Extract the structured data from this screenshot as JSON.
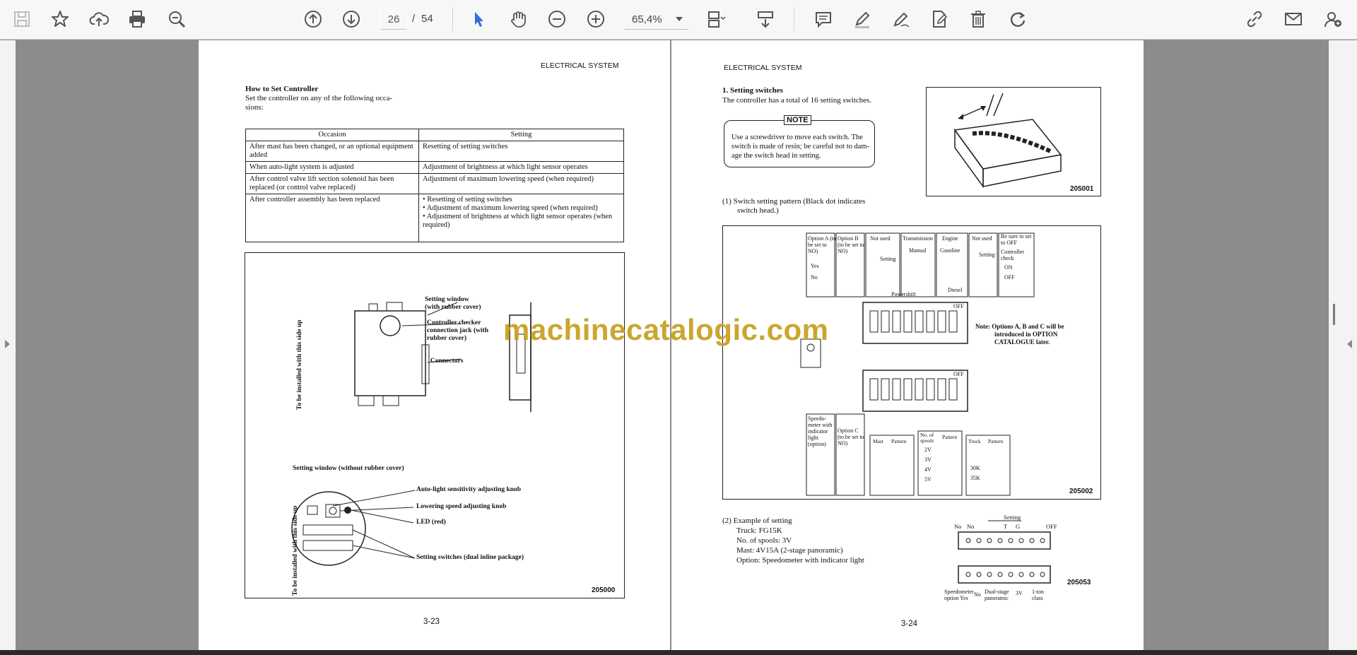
{
  "toolbar": {
    "current_page": "26",
    "page_separator": "/",
    "total_pages": "54",
    "zoom": "65,4%"
  },
  "left_page": {
    "header": "ELECTRICAL SYSTEM",
    "title": "How to Set Controller",
    "intro_line1": "Set the controller on any of the following occa-",
    "intro_line2": "sions:",
    "table": {
      "headers": [
        "Occasion",
        "Setting"
      ],
      "rows": [
        {
          "occasion": "After mast has been changed, or an optional equipment added",
          "setting": [
            "Resetting of setting switches"
          ]
        },
        {
          "occasion": "When auto-light system is adjusted",
          "setting": [
            "Adjustment of brightness at which light sensor operates"
          ]
        },
        {
          "occasion": "After control valve lift section solenoid has been replaced (or control valve replaced)",
          "setting": [
            "Adjustment of maximum lowering speed (when required)"
          ]
        },
        {
          "occasion": "After controller assembly has been replaced",
          "setting": [
            "Resetting of setting switches",
            "Adjustment of maximum lowering speed (when required)",
            "Adjustment of brightness at which light sensor operates (when required)"
          ]
        }
      ]
    },
    "figure": {
      "side_label": "To be installed with this side up",
      "setting_window_label_1": "Setting window",
      "setting_window_label_2": "(with rubber cover)",
      "checker_label_1": "Controller checker",
      "checker_label_2": "connection jack (with",
      "checker_label_3": "rubber cover)",
      "connectors_label": "Connectors",
      "window_title": "Setting window (without rubber cover)",
      "knob1": "Auto-light sensitivity adjusting knob",
      "knob2": "Lowering speed adjusting knob",
      "led": "LED (red)",
      "switches": "Setting switches (dual inline package)",
      "side_label_2": "To be installed with this side up",
      "fig_no": "205000"
    },
    "page_number": "3-23"
  },
  "right_page": {
    "header": "ELECTRICAL SYSTEM",
    "section_title": "1.  Setting switches",
    "section_text": "The controller has a total of 16 setting switches.",
    "note_label": "NOTE",
    "note_line1": "Use a screwdriver to move each switch. The",
    "note_line2": "switch is made of resin; be careful not to dam-",
    "note_line3": "age the switch head in setting.",
    "fig1_no": "205001",
    "pattern_line1": "(1)  Switch setting pattern (Black dot indicates",
    "pattern_line2": "switch head.)",
    "fig2": {
      "optA": "Option A (to be set to NO)",
      "optB": "Option B (to be set to NO)",
      "not_used": "Not used",
      "setting": "Setting",
      "transmission": "Transmission",
      "manual": "Manual",
      "powershift": "Powershift",
      "engine": "Engine",
      "gasoline": "Gasoline",
      "diesel": "Diesel",
      "not_used_2": "Not used",
      "setting_2": "Setting",
      "be_sure": "Be sure to set to OFF",
      "controller_check": "Controller check",
      "on": "ON",
      "off": "OFF",
      "yes": "Yes",
      "no": "No",
      "off_label": "OFF",
      "note_1": "Note: Options A, B and C will be",
      "note_2": "introduced in OPTION",
      "note_3": "CATALOGUE later.",
      "speedo": "Speedo-meter with indicator light (option)",
      "optC": "Option C (to be set to NO)",
      "mast": "Mast",
      "pattern": "Pattern",
      "spools": "No. of spools",
      "truck": "Truck",
      "spool_vals": [
        "2V",
        "3V",
        "4V",
        "5V"
      ],
      "truck_vals": [
        "30K",
        "35K"
      ],
      "fig_no": "205002"
    },
    "example": {
      "line1": "(2)  Example of setting",
      "line2": "Truck: FG15K",
      "line3": "No. of spools: 3V",
      "line4": "Mast: 4V15A (2-stage panoramic)",
      "line5": "Option: Speedometer with indicator light",
      "setting_lbl": "Setting",
      "no1": "No",
      "no2": "No",
      "t": "T",
      "g": "G",
      "off": "OFF",
      "speedo_lbl": "Speedometer option Yes",
      "no3": "No",
      "dual": "Dual-stage panoramic",
      "v3": "3V",
      "ton": "1-ton class",
      "fig_no": "205053"
    },
    "page_number": "3-24"
  },
  "watermark": "machinecatalogic.com"
}
